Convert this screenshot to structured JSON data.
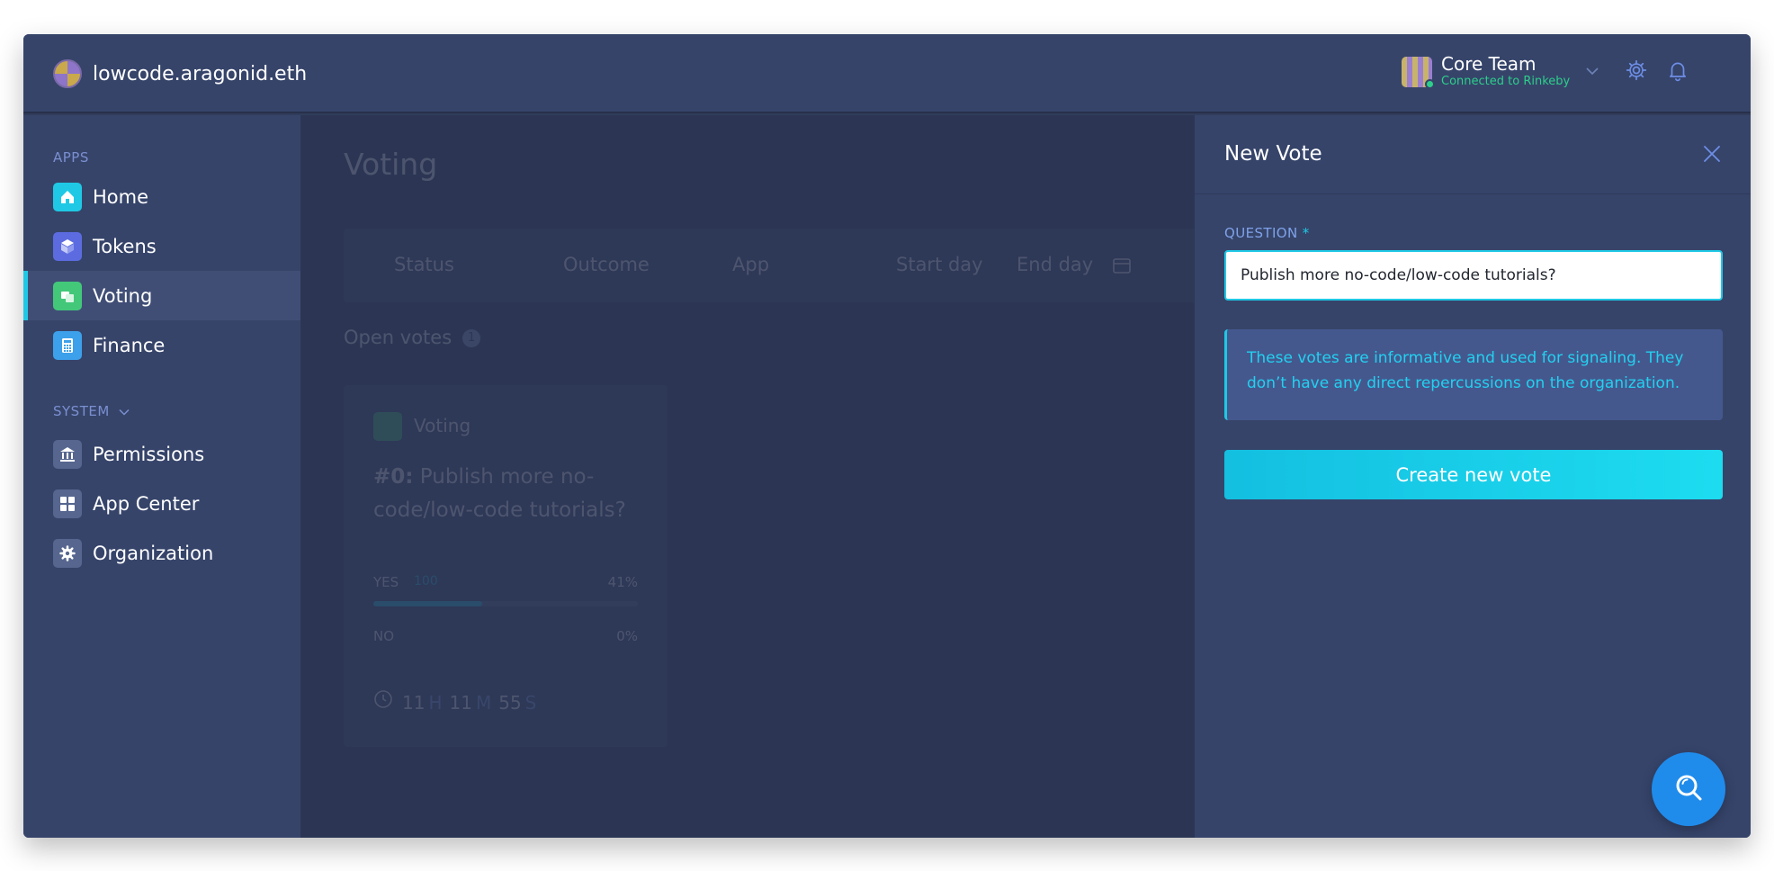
{
  "header": {
    "org_name": "lowcode.aragonid.eth",
    "account_name": "Core Team",
    "network_status": "Connected to Rinkeby",
    "icons": [
      "settings-gear-icon",
      "notifications-bell-icon"
    ]
  },
  "sidebar": {
    "apps_heading": "APPS",
    "apps": [
      {
        "label": "Home",
        "icon": "home-icon",
        "color": "#1fc9e5"
      },
      {
        "label": "Tokens",
        "icon": "tokens-icon",
        "color": "#5c6ce0"
      },
      {
        "label": "Voting",
        "icon": "voting-icon",
        "color": "#43c87a",
        "active": true
      },
      {
        "label": "Finance",
        "icon": "finance-icon",
        "color": "#3da0ea"
      }
    ],
    "system_heading": "SYSTEM",
    "system": [
      {
        "label": "Permissions",
        "icon": "permissions-icon"
      },
      {
        "label": "App Center",
        "icon": "app-center-icon"
      },
      {
        "label": "Organization",
        "icon": "organization-icon"
      }
    ]
  },
  "main": {
    "title": "Voting",
    "filters": {
      "status": "Status",
      "outcome": "Outcome",
      "app": "App",
      "start_day": "Start day",
      "end_day": "End day"
    },
    "open_votes_label": "Open votes",
    "open_votes_count": "1",
    "vote_card": {
      "app_label": "Voting",
      "number": "#0:",
      "question": "Publish more no-code/low-code tutorials?",
      "yes_label": "YES",
      "yes_amount": "100",
      "yes_percent": "41%",
      "yes_progress": 0.41,
      "no_label": "NO",
      "no_percent": "0%",
      "no_progress": 0,
      "timer_hours": "11",
      "timer_h_unit": "H",
      "timer_minutes": "11",
      "timer_m_unit": "M",
      "timer_seconds": "55",
      "timer_s_unit": "S"
    }
  },
  "panel": {
    "title": "New Vote",
    "question_label": "QUESTION",
    "required_mark": "*",
    "question_value": "Publish more no-code/low-code tutorials?",
    "info_text": "These votes are informative and used for signaling. They don’t have any direct repercussions on the organization.",
    "create_button": "Create new vote"
  },
  "colors": {
    "accent": "#1fc9e5",
    "help_button": "#1f8cec",
    "connected": "#2ccf8a",
    "panel_background": "#36446a"
  }
}
